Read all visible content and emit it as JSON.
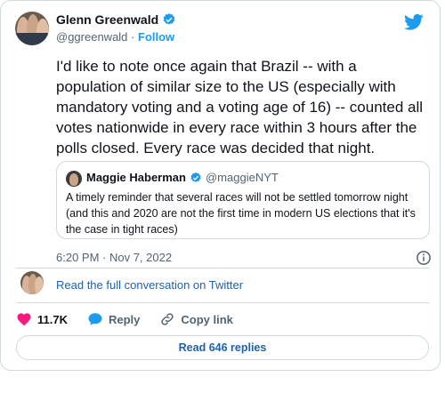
{
  "author": {
    "name": "Glenn Greenwald",
    "handle": "@ggreenwald",
    "separator": "·",
    "follow_label": "Follow"
  },
  "tweet": {
    "text": "I'd like to note once again that Brazil -- with a population of similar size to the US (especially with mandatory voting and a voting age of 16) -- counted all votes nationwide in every race within 3 hours after the polls closed. Every race was decided that night.",
    "timestamp": "6:20 PM · Nov 7, 2022"
  },
  "quote": {
    "name": "Maggie Haberman",
    "handle": "@maggieNYT",
    "text": "A timely reminder that several races will not be settled tomorrow night (and this and 2020 are not the first time in modern US elections that it's the case in tight races)"
  },
  "read_full_label": "Read the full conversation on Twitter",
  "actions": {
    "likes": "11.7K",
    "reply_label": "Reply",
    "copy_link_label": "Copy link"
  },
  "replies_button_label": "Read 646 replies",
  "colors": {
    "accent": "#1d9bf0",
    "link": "#1d62b0",
    "heart": "#f91880",
    "muted": "#536471",
    "border": "#cfd9de"
  },
  "icons": [
    "verified-badge-icon",
    "twitter-bird-icon",
    "info-icon",
    "heart-icon",
    "reply-bubble-icon",
    "link-icon"
  ]
}
